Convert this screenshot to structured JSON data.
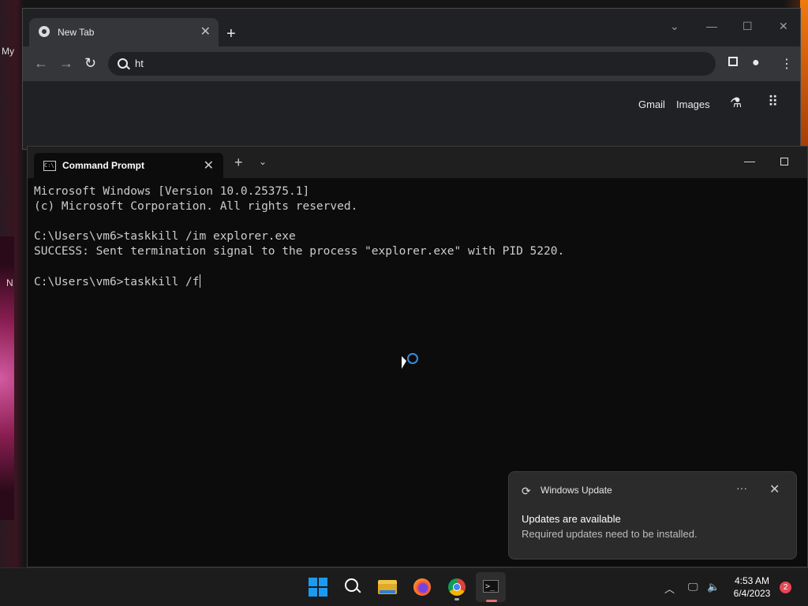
{
  "desktop": {
    "label_top": "My",
    "label_mid": "N"
  },
  "chrome": {
    "tab_title": "New Tab",
    "omnibox_value": "ht",
    "links": {
      "gmail": "Gmail",
      "images": "Images"
    }
  },
  "terminal": {
    "tab_title": "Command Prompt",
    "lines": [
      "Microsoft Windows [Version 10.0.25375.1]",
      "(c) Microsoft Corporation. All rights reserved.",
      "",
      "C:\\Users\\vm6>taskkill /im explorer.exe",
      "SUCCESS: Sent termination signal to the process \"explorer.exe\" with PID 5220.",
      ""
    ],
    "prompt_line": "C:\\Users\\vm6>taskkill /f"
  },
  "toast": {
    "app_name": "Windows Update",
    "heading": "Updates are available",
    "body": "Required updates need to be installed."
  },
  "taskbar": {
    "time": "4:53 AM",
    "date": "6/4/2023",
    "notification_count": "2"
  }
}
